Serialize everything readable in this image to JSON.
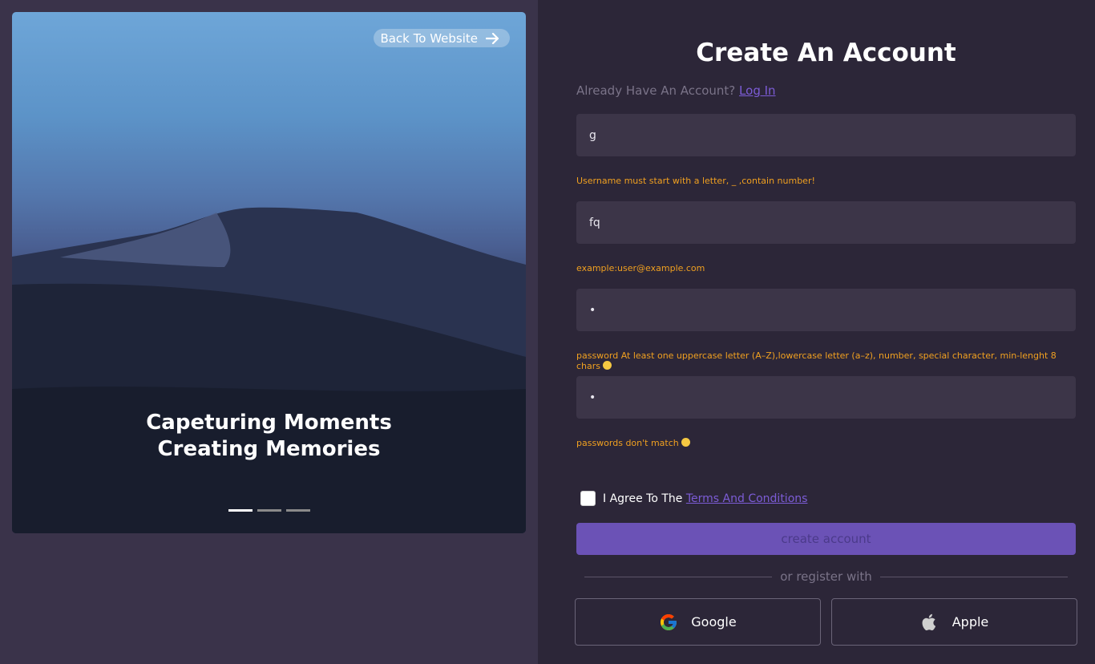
{
  "hero": {
    "back_label": "Back To Website",
    "tagline_line1": "Capeturing Moments",
    "tagline_line2": "Creating Memories",
    "carousel_active_index": 0,
    "carousel_count": 3
  },
  "form": {
    "title": "Create An Account",
    "login_prompt": "Already Have An Account?",
    "login_link": "Log In",
    "username_value": "g",
    "username_hint": "Username must start with a letter, _ ,contain number!",
    "email_value": "fq",
    "email_hint": "example:user@example.com",
    "password_value": "•",
    "password_hint": "password At least one uppercase letter (A–Z),lowercase letter (a–z), number, special character, min-lenght 8 chars",
    "confirm_value": "•",
    "confirm_hint": "passwords don't match",
    "agree_text": "I Agree To The",
    "terms_link": "Terms And Conditions",
    "submit_label": "create account",
    "divider_text": "or register with",
    "google_label": "Google",
    "apple_label": "Apple"
  },
  "colors": {
    "accent": "#6b52b6",
    "link": "#7c5cd6",
    "warning": "#f0a020",
    "field_bg": "#3c3548",
    "page_bg": "#2c2638"
  }
}
